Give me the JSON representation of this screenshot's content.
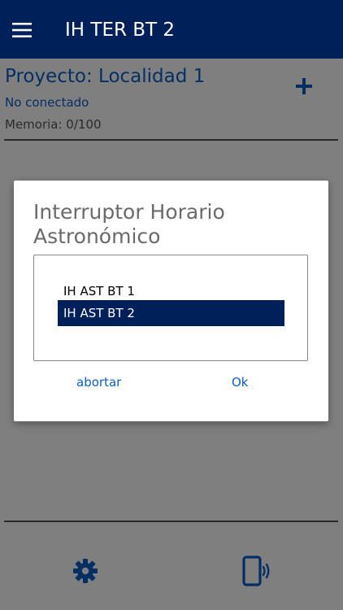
{
  "app_bar": {
    "title": "IH TER BT 2",
    "background_color": "#00205b",
    "menu_icon": "hamburger-menu-icon"
  },
  "project": {
    "title": "Proyecto: Localidad 1",
    "connection_status": "No conectado",
    "memory": "Memoria: 0/100",
    "add_icon": "plus-icon",
    "accent_color": "#0b5fc7"
  },
  "bottom_bar": {
    "settings_icon": "gear-icon",
    "device_icon": "phone-vibrate-icon"
  },
  "dialog": {
    "title": "Interruptor Horario Astronómico",
    "options": [
      {
        "label": "IH AST BT 1",
        "selected": false
      },
      {
        "label": "IH AST BT 2",
        "selected": true
      }
    ],
    "cancel_label": "abortar",
    "ok_label": "Ok",
    "selected_color": "#00205b"
  }
}
